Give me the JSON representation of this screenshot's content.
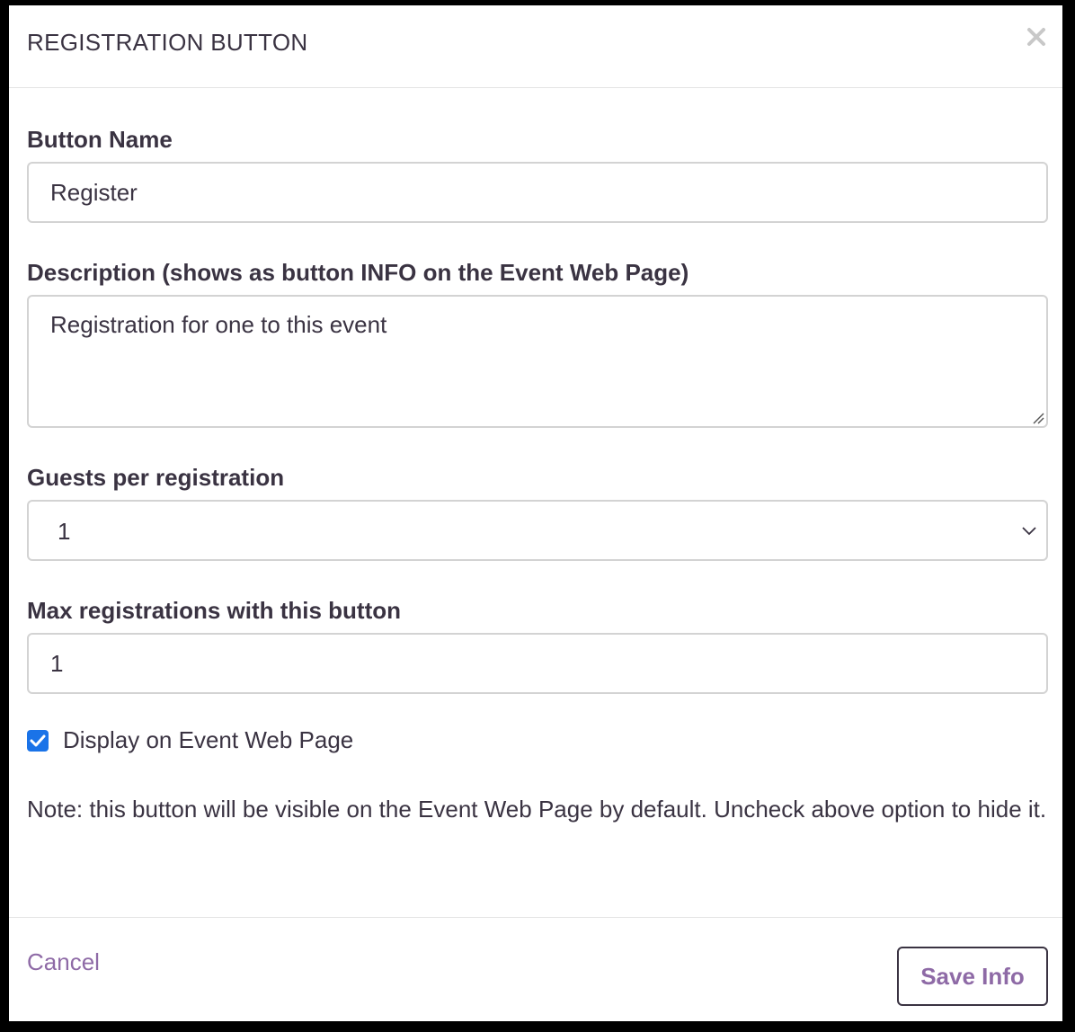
{
  "modal": {
    "title": "REGISTRATION BUTTON",
    "close_icon": "close-icon"
  },
  "form": {
    "button_name": {
      "label": "Button Name",
      "value": "Register"
    },
    "description": {
      "label": "Description (shows as button INFO on the Event Web Page)",
      "value": "Registration for one to this event"
    },
    "guests_per_registration": {
      "label": "Guests per registration",
      "selected": "1"
    },
    "max_registrations": {
      "label": "Max registrations with this button",
      "value": "1"
    },
    "display_checkbox": {
      "label": "Display on Event Web Page",
      "checked": true
    },
    "note": "Note: this button will be visible on the Event Web Page by default. Uncheck above option to hide it."
  },
  "footer": {
    "cancel_label": "Cancel",
    "save_label": "Save Info"
  },
  "colors": {
    "text": "#3a3342",
    "accent": "#8e6aa6",
    "checkbox": "#1a73e8",
    "border": "#d3d3d3"
  }
}
